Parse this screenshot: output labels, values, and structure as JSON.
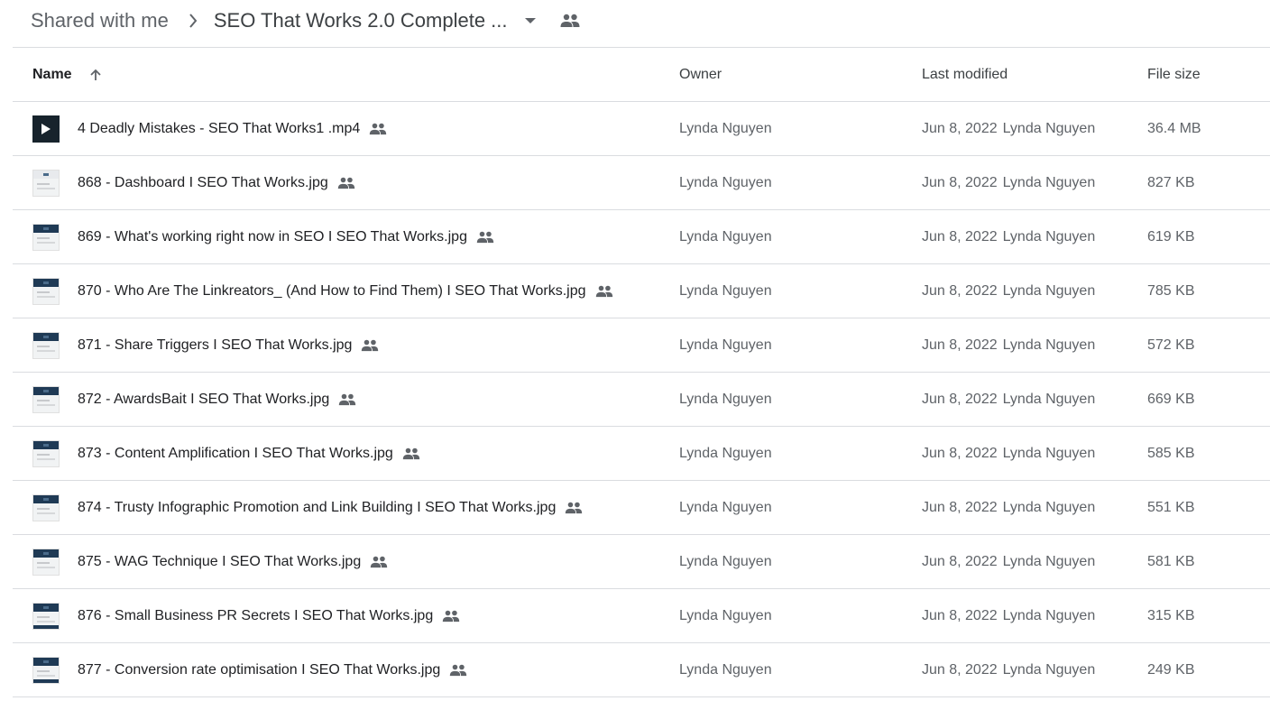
{
  "breadcrumb": {
    "root": "Shared with me",
    "current": "SEO That Works 2.0 Complete ..."
  },
  "columns": {
    "name": "Name",
    "owner": "Owner",
    "last_modified": "Last modified",
    "file_size": "File size"
  },
  "files": [
    {
      "name": "4 Deadly Mistakes - SEO That Works1 .mp4",
      "owner": "Lynda Nguyen",
      "modified_date": "Jun 8, 2022",
      "modified_by": "Lynda Nguyen",
      "size": "36.4 MB",
      "type": "video"
    },
    {
      "name": "868 - Dashboard I SEO That Works.jpg",
      "owner": "Lynda Nguyen",
      "modified_date": "Jun 8, 2022",
      "modified_by": "Lynda Nguyen",
      "size": "827 KB",
      "type": "image"
    },
    {
      "name": "869 - What's working right now in SEO I SEO That Works.jpg",
      "owner": "Lynda Nguyen",
      "modified_date": "Jun 8, 2022",
      "modified_by": "Lynda Nguyen",
      "size": "619 KB",
      "type": "image"
    },
    {
      "name": "870 - Who Are The Linkreators_ (And How to Find Them) I SEO That Works.jpg",
      "owner": "Lynda Nguyen",
      "modified_date": "Jun 8, 2022",
      "modified_by": "Lynda Nguyen",
      "size": "785 KB",
      "type": "image"
    },
    {
      "name": "871 - Share Triggers I SEO That Works.jpg",
      "owner": "Lynda Nguyen",
      "modified_date": "Jun 8, 2022",
      "modified_by": "Lynda Nguyen",
      "size": "572 KB",
      "type": "image"
    },
    {
      "name": "872 - AwardsBait I SEO That Works.jpg",
      "owner": "Lynda Nguyen",
      "modified_date": "Jun 8, 2022",
      "modified_by": "Lynda Nguyen",
      "size": "669 KB",
      "type": "image"
    },
    {
      "name": "873 - Content Amplification I SEO That Works.jpg",
      "owner": "Lynda Nguyen",
      "modified_date": "Jun 8, 2022",
      "modified_by": "Lynda Nguyen",
      "size": "585 KB",
      "type": "image"
    },
    {
      "name": "874 - Trusty Infographic Promotion and Link Building I SEO That Works.jpg",
      "owner": "Lynda Nguyen",
      "modified_date": "Jun 8, 2022",
      "modified_by": "Lynda Nguyen",
      "size": "551 KB",
      "type": "image"
    },
    {
      "name": "875 - WAG Technique I SEO That Works.jpg",
      "owner": "Lynda Nguyen",
      "modified_date": "Jun 8, 2022",
      "modified_by": "Lynda Nguyen",
      "size": "581 KB",
      "type": "image"
    },
    {
      "name": "876 - Small Business PR Secrets I SEO That Works.jpg",
      "owner": "Lynda Nguyen",
      "modified_date": "Jun 8, 2022",
      "modified_by": "Lynda Nguyen",
      "size": "315 KB",
      "type": "image"
    },
    {
      "name": "877 - Conversion rate optimisation I SEO That Works.jpg",
      "owner": "Lynda Nguyen",
      "modified_date": "Jun 8, 2022",
      "modified_by": "Lynda Nguyen",
      "size": "249 KB",
      "type": "image"
    }
  ],
  "icons": {
    "sort": "arrow-up-icon",
    "shared": "people-icon",
    "separator": "chevron-right-icon",
    "dropdown": "caret-down-icon",
    "video": "play-icon"
  },
  "colors": {
    "text": "#3c4043",
    "muted": "#5f6368",
    "divider": "#dadce0",
    "video_thumb": "#17232c"
  }
}
